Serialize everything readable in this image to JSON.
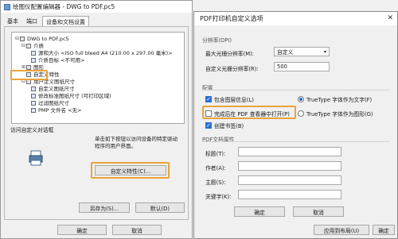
{
  "colors": {
    "highlight": "#e8a33d",
    "accent": "#2a6fce"
  },
  "left_dialog": {
    "title": "绘图仪配置编辑器 - DWG to PDF.pc5",
    "tabs": [
      "基本",
      "端口",
      "设备和文档设置"
    ],
    "tree": [
      "DWG to PDF.pc5",
      "介质",
      "源和大小 <ISO full bleed A4 (210.00 x 297.00 毫米)>",
      "介质目标 <不可用>",
      "图形",
      "自定义特性",
      "用户定义图纸尺寸",
      "自定义图纸尺寸",
      "修改标准图纸尺寸 (可打印区域)",
      "过滤图纸尺寸",
      "PMP 文件名 <无>"
    ],
    "section_label": "访问自定义对话框",
    "description": "单击如下按钮以访问设备的特定驱动程序的用户界面。",
    "custom_props_button": "自定义特性(C)...",
    "save_as_button": "另存为(S)...",
    "default_button": "默认(D)",
    "ok_button": "确定",
    "cancel_button": "取消"
  },
  "right_dialog": {
    "title": "PDF打印机自定义选项",
    "resolution_section": "分辨率(DPI)",
    "max_res_label": "最大光栅分辨率(M):",
    "max_res_value": "自定义",
    "custom_res_label": "自定义光栅分辨率(R):",
    "custom_res_value": "500",
    "config_section": "配置",
    "include_layer_label": "包含图层信息(L)",
    "open_in_viewer_label": "完成后在 PDF 查看器中打开(P)",
    "create_bookmarks_label": "创建书签(B)",
    "truetype_text_label": "TrueType 字体作为文字(F)",
    "truetype_graphics_label": "TrueType 字体作为图形(G)",
    "props_section": "PDF文档属性",
    "title_label": "标题(T):",
    "author_label": "作者(A):",
    "subject_label": "主题(S):",
    "keywords_label": "关键字(K):",
    "ok_button": "确定",
    "cancel_button": "取消",
    "apply_to_layout_button": "应用到布局(U)"
  }
}
